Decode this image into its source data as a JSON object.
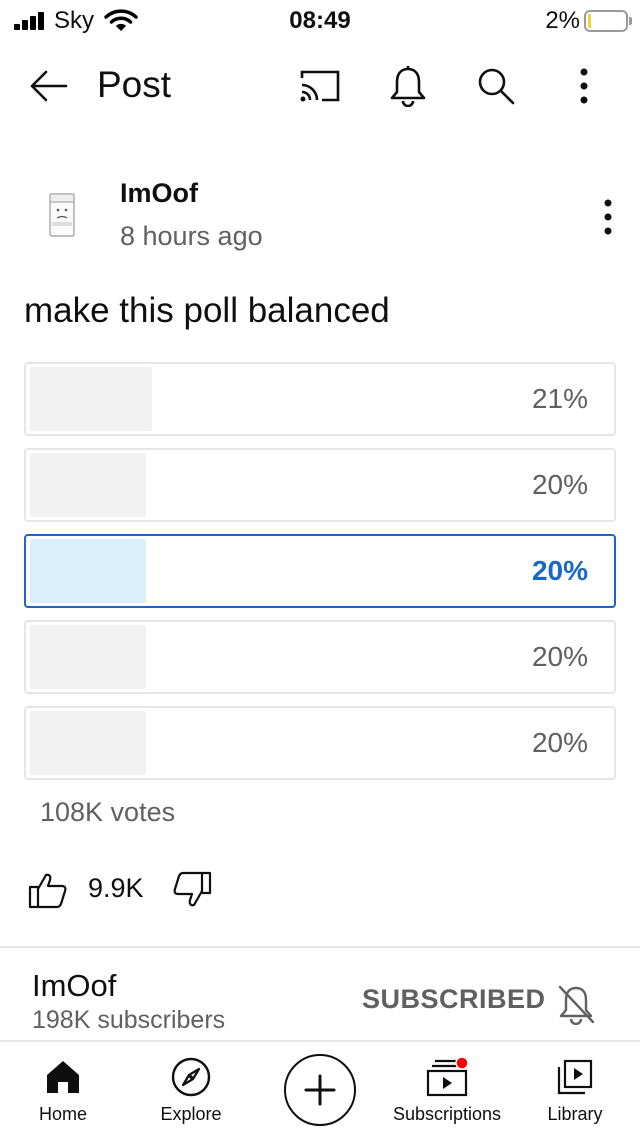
{
  "status_bar": {
    "carrier": "Sky",
    "time": "08:49",
    "battery_percent": "2%",
    "battery_color": "#f4d23a"
  },
  "header": {
    "title": "Post",
    "icons": [
      "back-arrow-icon",
      "cast-icon",
      "bell-icon",
      "search-icon",
      "more-vertical-icon"
    ]
  },
  "post": {
    "author": "ImOof",
    "time_ago": "8 hours ago",
    "text": "make this poll balanced",
    "poll": {
      "options": [
        {
          "percent_label": "21%",
          "value": 21,
          "selected": false
        },
        {
          "percent_label": "20%",
          "value": 20,
          "selected": false
        },
        {
          "percent_label": "20%",
          "value": 20,
          "selected": true
        },
        {
          "percent_label": "20%",
          "value": 20,
          "selected": false
        },
        {
          "percent_label": "20%",
          "value": 20,
          "selected": false
        }
      ],
      "votes": "108K votes",
      "accent_color": "#1967c8",
      "selected_fill_color": "#dbeefc"
    },
    "likes": "9.9K"
  },
  "channel": {
    "name": "ImOof",
    "subscribers": "198K subscribers",
    "subscribed_label": "SUBSCRIBED"
  },
  "bottom_nav": {
    "items": [
      {
        "label": "Home",
        "icon": "home-icon"
      },
      {
        "label": "Explore",
        "icon": "compass-icon"
      },
      {
        "label": "",
        "icon": "create-plus-icon"
      },
      {
        "label": "Subscriptions",
        "icon": "subscriptions-icon"
      },
      {
        "label": "Library",
        "icon": "library-icon"
      }
    ],
    "notification_dot_color": "#ff0000"
  }
}
